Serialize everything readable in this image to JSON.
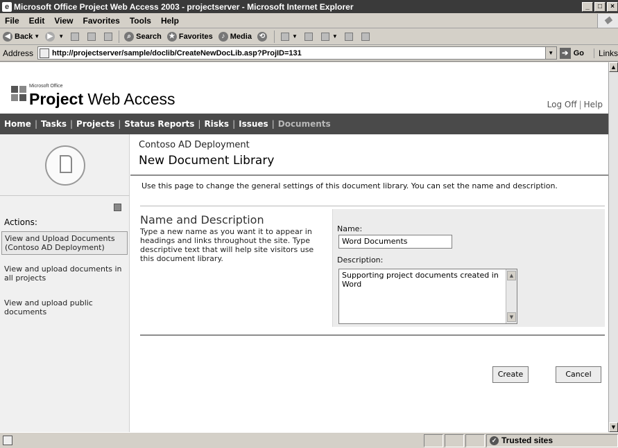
{
  "window": {
    "title": "Microsoft Office Project Web Access 2003 - projectserver - Microsoft Internet Explorer",
    "minimize": "_",
    "maximize": "□",
    "close": "×"
  },
  "menu": [
    "File",
    "Edit",
    "View",
    "Favorites",
    "Tools",
    "Help"
  ],
  "toolbar": {
    "back": "Back",
    "search": "Search",
    "favorites": "Favorites",
    "media": "Media"
  },
  "address": {
    "label": "Address",
    "url": "http://projectserver/sample/doclib/CreateNewDocLib.asp?ProjID=131",
    "go": "Go",
    "links": "Links"
  },
  "header": {
    "logo_small": "Microsoft Office",
    "logo_bold": "Project",
    "logo_rest": " Web Access",
    "log_off": "Log Off",
    "help": "Help"
  },
  "nav": {
    "items": [
      "Home",
      "Tasks",
      "Projects",
      "Status Reports",
      "Risks",
      "Issues",
      "Documents"
    ],
    "current": "Documents"
  },
  "sidebar": {
    "actions_label": "Actions:",
    "links": [
      "View and Upload Documents (Contoso AD Deployment)",
      "View and upload documents in all projects",
      "View and upload public documents"
    ]
  },
  "main": {
    "project_name": "Contoso AD Deployment",
    "page_title": "New Document Library",
    "intro": "Use this page to change the general settings of this document library. You can set the name and description.",
    "section_title": "Name and Description",
    "section_desc": "Type a new name as you want it to appear in headings and links throughout the site. Type descriptive text that will help site visitors use this document library.",
    "name_label": "Name:",
    "name_value": "Word Documents",
    "description_label": "Description:",
    "description_value": "Supporting project documents created in Word",
    "create_button": "Create",
    "cancel_button": "Cancel"
  },
  "status": {
    "zone": "Trusted sites"
  },
  "colors": {
    "nav_bg": "#4a4a4a",
    "title_bg": "#3a3a3a",
    "left_pane_bg": "#f0f0f0",
    "form_bg": "#ececec"
  }
}
